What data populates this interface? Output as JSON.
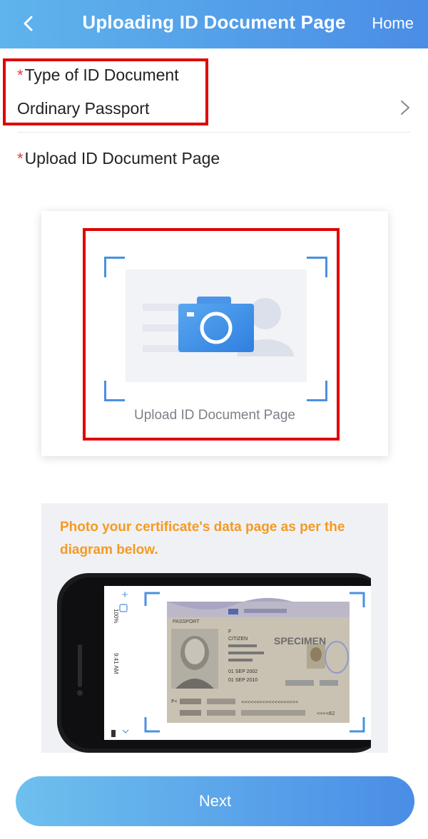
{
  "header": {
    "title": "Uploading ID Document Page",
    "home_label": "Home"
  },
  "form": {
    "required_mark": "*",
    "doc_type_label": "Type of ID Document",
    "doc_type_value": "Ordinary Passport",
    "upload_label": "Upload ID Document Page"
  },
  "upload": {
    "caption": "Upload ID Document Page"
  },
  "tip": {
    "text": "Photo your certificate's data page as per the diagram below."
  },
  "passport_sample": {
    "status_bar": [
      "100%",
      "9:41 AM"
    ],
    "passport_word": "PASSPORT",
    "specimen_word": "SPECIMEN",
    "name": "CITIZEN",
    "sex": "F",
    "date1": "01 SEP 2002",
    "date2": "01 SEP 2010",
    "mrz_line1": "P<",
    "mrz_tail": "<<<<82"
  },
  "buttons": {
    "next": "Next"
  },
  "colors": {
    "header_start": "#5fb4ec",
    "header_end": "#4a8de6",
    "required": "#e23a3a",
    "tip": "#f59a23",
    "highlight": "#e00000"
  }
}
